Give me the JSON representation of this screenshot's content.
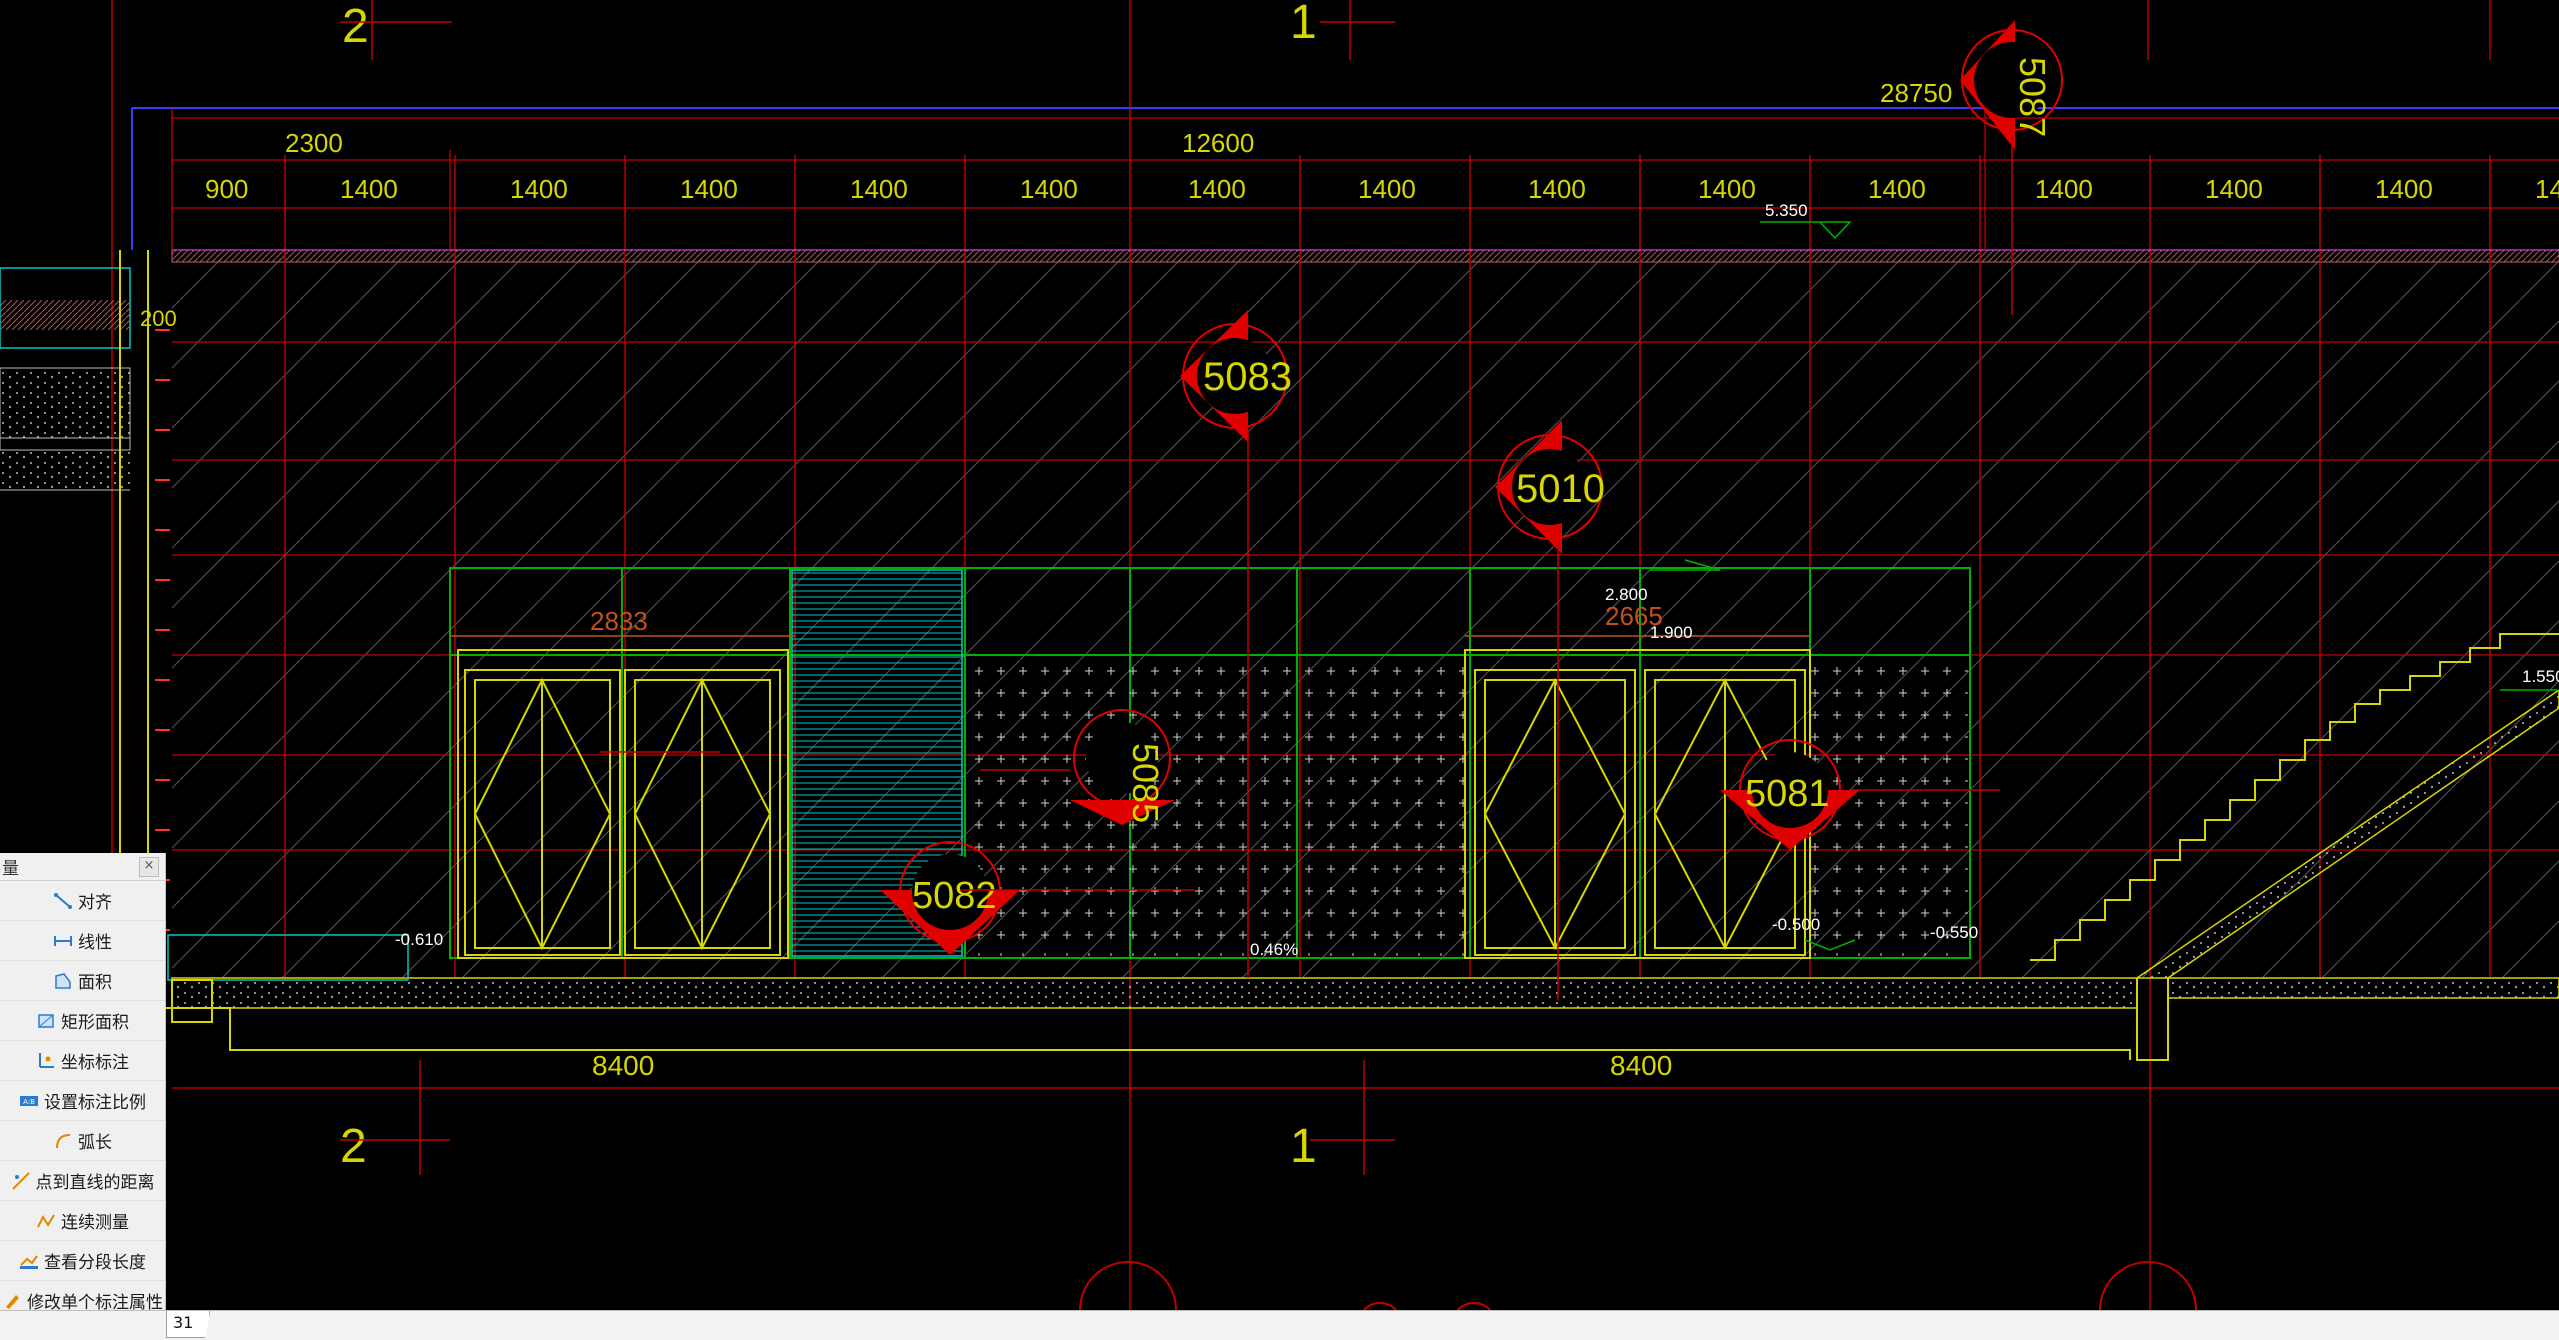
{
  "drawing": {
    "axis_labels": {
      "top_left": "2",
      "top_center": "1",
      "bottom_left": "2",
      "bottom_center": "1"
    },
    "total_dim": "28750",
    "span_dims": {
      "left": "2300",
      "center": "12600"
    },
    "segment_dims": [
      "900",
      "1400",
      "1400",
      "1400",
      "1400",
      "1400",
      "1400",
      "1400",
      "1400",
      "1400",
      "1400",
      "1400",
      "1400",
      "1400",
      "14"
    ],
    "bottom_dims": {
      "left": "8400",
      "right": "8400"
    },
    "small_dim": "200",
    "levels": {
      "top": "5.350",
      "door": "2.800",
      "mid": "1.900",
      "stair": "1.550",
      "left_floor": "-0.610",
      "floor1": "-0.500",
      "floor2": "-0.550"
    },
    "door_widths": {
      "left": "2833",
      "right": "2665"
    },
    "slope": "0.46%",
    "callouts": {
      "c1": "5083",
      "c2": "5010",
      "c3": "5085",
      "c4": "5082",
      "c5": "5081",
      "c6": "5087"
    }
  },
  "panel": {
    "title": "量",
    "close": "×",
    "tools": [
      {
        "label": "对齐",
        "icon": "align-icon"
      },
      {
        "label": "线性",
        "icon": "linear-dim-icon"
      },
      {
        "label": "面积",
        "icon": "area-icon"
      },
      {
        "label": "矩形面积",
        "icon": "rect-area-icon"
      },
      {
        "label": "坐标标注",
        "icon": "coordinate-icon"
      },
      {
        "label": "设置标注比例",
        "icon": "scale-icon"
      },
      {
        "label": "弧长",
        "icon": "arc-icon"
      },
      {
        "label": "点到直线的距离",
        "icon": "point-line-icon"
      },
      {
        "label": "连续测量",
        "icon": "continuous-icon"
      },
      {
        "label": "查看分段长度",
        "icon": "segment-icon"
      },
      {
        "label": "修改单个标注属性",
        "icon": "edit-dim-icon"
      }
    ]
  },
  "tabbar": {
    "tab_label": "31"
  },
  "colors": {
    "red": "#e00000",
    "yellow": "#d6d600",
    "green": "#00b000",
    "cyan": "#00c8c8",
    "blue": "#3a3aff",
    "bg": "#000000"
  }
}
